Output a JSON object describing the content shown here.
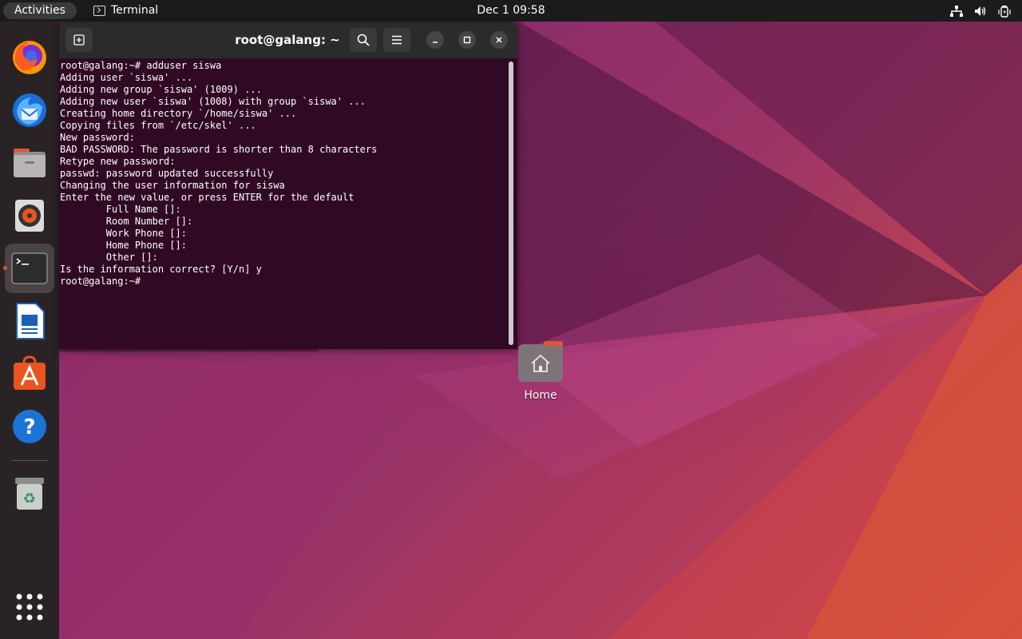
{
  "topbar": {
    "activities_label": "Activities",
    "app_name": "Terminal",
    "clock": "Dec 1  09:58"
  },
  "dock": {
    "items": [
      {
        "name": "firefox-icon"
      },
      {
        "name": "thunderbird-icon"
      },
      {
        "name": "files-icon"
      },
      {
        "name": "rhythmbox-icon"
      },
      {
        "name": "terminal-icon",
        "active": true
      },
      {
        "name": "writer-icon"
      },
      {
        "name": "software-icon"
      },
      {
        "name": "help-icon"
      },
      {
        "name": "trash-icon"
      },
      {
        "name": "app-grid-icon"
      }
    ]
  },
  "terminal": {
    "title": "root@galang: ~",
    "lines": [
      "root@galang:~# adduser siswa",
      "Adding user `siswa' ...",
      "Adding new group `siswa' (1009) ...",
      "Adding new user `siswa' (1008) with group `siswa' ...",
      "Creating home directory `/home/siswa' ...",
      "Copying files from `/etc/skel' ...",
      "New password: ",
      "BAD PASSWORD: The password is shorter than 8 characters",
      "Retype new password: ",
      "passwd: password updated successfully",
      "Changing the user information for siswa",
      "Enter the new value, or press ENTER for the default",
      "        Full Name []: ",
      "        Room Number []: ",
      "        Work Phone []: ",
      "        Home Phone []: ",
      "        Other []: ",
      "Is the information correct? [Y/n] y",
      "root@galang:~# "
    ]
  },
  "desktop": {
    "home_label": "Home"
  },
  "colors": {
    "terminal_bg": "#300a24",
    "ubuntu_orange": "#e95420",
    "dock_bg": "#2a2326",
    "topbar_bg": "#1b1b1b"
  }
}
